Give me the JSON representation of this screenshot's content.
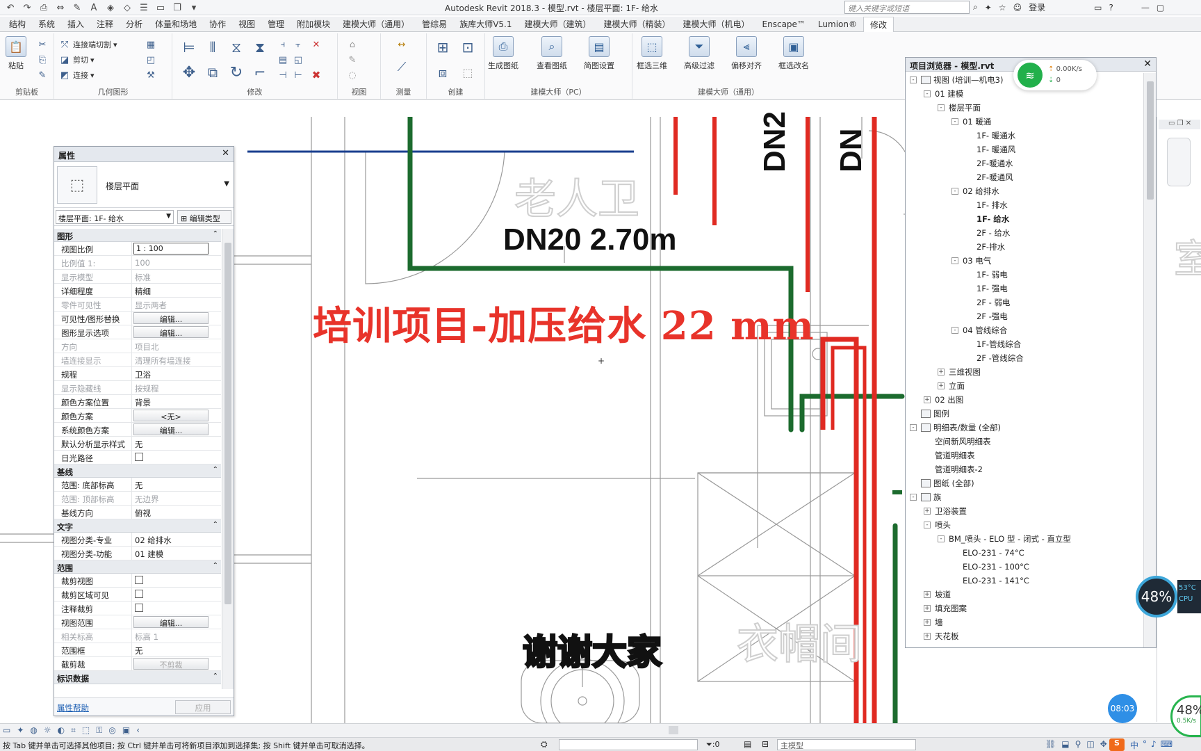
{
  "app": {
    "title": "Autodesk Revit 2018.3 -     模型.rvt - 楼层平面: 1F- 给水",
    "search_placeholder": "键入关键字或短语",
    "login": "登录"
  },
  "tabs": [
    "结构",
    "系统",
    "插入",
    "注释",
    "分析",
    "体量和场地",
    "协作",
    "视图",
    "管理",
    "附加模块",
    "建模大师（通用）",
    "管综易",
    "族库大师V5.1",
    "建模大师（建筑）",
    "建模大师（精装）",
    "建模大师（机电）",
    "Enscape™",
    "Lumion®",
    "修改"
  ],
  "active_tab": "修改",
  "ribbon": {
    "groups": [
      "剪贴板",
      "几何图形",
      "修改",
      "视图",
      "测量",
      "创建",
      "建模大师（PC）",
      "建模大师（通用）"
    ],
    "clipboard_paste": "粘贴",
    "geometry_items": [
      "连接端切割",
      "剪切",
      "连接"
    ],
    "pc_buttons": [
      "生成图纸",
      "查看图纸",
      "简图设置"
    ],
    "general_buttons": [
      "框选三维",
      "高级过滤",
      "偏移对齐",
      "框选改名"
    ]
  },
  "properties": {
    "title": "属性",
    "type_name": "楼层平面",
    "filter": "楼层平面: 1F- 给水",
    "edit_type": "编辑类型",
    "categories": {
      "graphics": "图形",
      "underlay": "基线",
      "text": "文字",
      "extents": "范围",
      "identity": "标识数据"
    },
    "graphics_rows": [
      {
        "k": "视图比例",
        "v": "1 : 100",
        "kind": "input"
      },
      {
        "k": "比例值 1:",
        "v": "100",
        "kind": "dim"
      },
      {
        "k": "显示模型",
        "v": "标准",
        "kind": "dim"
      },
      {
        "k": "详细程度",
        "v": "精细",
        "kind": "text"
      },
      {
        "k": "零件可见性",
        "v": "显示两者",
        "kind": "dim"
      },
      {
        "k": "可见性/图形替换",
        "v": "编辑...",
        "kind": "button"
      },
      {
        "k": "图形显示选项",
        "v": "编辑...",
        "kind": "button"
      },
      {
        "k": "方向",
        "v": "项目北",
        "kind": "dim"
      },
      {
        "k": "墙连接显示",
        "v": "清理所有墙连接",
        "kind": "dim"
      },
      {
        "k": "规程",
        "v": "卫浴",
        "kind": "text"
      },
      {
        "k": "显示隐藏线",
        "v": "按规程",
        "kind": "dim"
      },
      {
        "k": "颜色方案位置",
        "v": "背景",
        "kind": "text"
      },
      {
        "k": "颜色方案",
        "v": "<无>",
        "kind": "button"
      },
      {
        "k": "系统颜色方案",
        "v": "编辑...",
        "kind": "button"
      },
      {
        "k": "默认分析显示样式",
        "v": "无",
        "kind": "text"
      },
      {
        "k": "日光路径",
        "v": "",
        "kind": "checkbox"
      }
    ],
    "underlay_rows": [
      {
        "k": "范围: 底部标高",
        "v": "无",
        "kind": "text"
      },
      {
        "k": "范围: 顶部标高",
        "v": "无边界",
        "kind": "dim"
      },
      {
        "k": "基线方向",
        "v": "俯视",
        "kind": "text"
      }
    ],
    "text_rows": [
      {
        "k": "视图分类-专业",
        "v": "02 给排水",
        "kind": "text"
      },
      {
        "k": "视图分类-功能",
        "v": "01 建模",
        "kind": "text"
      }
    ],
    "extents_rows": [
      {
        "k": "裁剪视图",
        "v": "",
        "kind": "checkbox"
      },
      {
        "k": "裁剪区域可见",
        "v": "",
        "kind": "checkbox"
      },
      {
        "k": "注释裁剪",
        "v": "",
        "kind": "checkbox"
      },
      {
        "k": "视图范围",
        "v": "编辑...",
        "kind": "button"
      },
      {
        "k": "相关标高",
        "v": "标高 1",
        "kind": "dim"
      },
      {
        "k": "范围框",
        "v": "无",
        "kind": "text"
      },
      {
        "k": "截剪裁",
        "v": "不剪裁",
        "kind": "buttondim"
      }
    ],
    "help_link": "属性帮助",
    "apply": "应用"
  },
  "browser": {
    "title": "项目浏览器 - 模型.rvt",
    "nodes": [
      {
        "label": "视图 (培训—机电3)",
        "lvl": 0,
        "exp": "-",
        "icon": true
      },
      {
        "label": "01 建模",
        "lvl": 1,
        "exp": "-"
      },
      {
        "label": "楼层平面",
        "lvl": 2,
        "exp": "-"
      },
      {
        "label": "01 暖通",
        "lvl": 3,
        "exp": "-"
      },
      {
        "label": "1F- 暖通水",
        "lvl": 4
      },
      {
        "label": "1F- 暖通风",
        "lvl": 4
      },
      {
        "label": "2F-暖通水",
        "lvl": 4
      },
      {
        "label": "2F-暖通风",
        "lvl": 4
      },
      {
        "label": "02 给排水",
        "lvl": 3,
        "exp": "-"
      },
      {
        "label": "1F- 排水",
        "lvl": 4
      },
      {
        "label": "1F- 给水",
        "lvl": 4,
        "bold": true
      },
      {
        "label": "2F - 给水",
        "lvl": 4
      },
      {
        "label": "2F-排水",
        "lvl": 4
      },
      {
        "label": "03 电气",
        "lvl": 3,
        "exp": "-"
      },
      {
        "label": "1F- 弱电",
        "lvl": 4
      },
      {
        "label": "1F- 强电",
        "lvl": 4
      },
      {
        "label": "2F - 弱电",
        "lvl": 4
      },
      {
        "label": "2F -强电",
        "lvl": 4
      },
      {
        "label": "04 管线综合",
        "lvl": 3,
        "exp": "-"
      },
      {
        "label": "1F-管线综合",
        "lvl": 4
      },
      {
        "label": "2F -管线综合",
        "lvl": 4
      },
      {
        "label": "三维视图",
        "lvl": 2,
        "exp": "+"
      },
      {
        "label": "立面",
        "lvl": 2,
        "exp": "+"
      },
      {
        "label": "02 出图",
        "lvl": 1,
        "exp": "+"
      },
      {
        "label": "图例",
        "lvl": 0,
        "icon": true
      },
      {
        "label": "明细表/数量 (全部)",
        "lvl": 0,
        "exp": "-",
        "icon": true
      },
      {
        "label": "空间新风明细表",
        "lvl": 1
      },
      {
        "label": "管道明细表",
        "lvl": 1
      },
      {
        "label": "管道明细表-2",
        "lvl": 1
      },
      {
        "label": "图纸 (全部)",
        "lvl": 0,
        "icon": true
      },
      {
        "label": "族",
        "lvl": 0,
        "exp": "-",
        "icon": true
      },
      {
        "label": "卫浴装置",
        "lvl": 1,
        "exp": "+"
      },
      {
        "label": "喷头",
        "lvl": 1,
        "exp": "-"
      },
      {
        "label": "BM_喷头 - ELO 型 - 闭式 - 直立型",
        "lvl": 2,
        "exp": "-"
      },
      {
        "label": "ELO-231 - 74°C",
        "lvl": 3
      },
      {
        "label": "ELO-231 - 100°C",
        "lvl": 3
      },
      {
        "label": "ELO-231 - 141°C",
        "lvl": 3
      },
      {
        "label": "坡道",
        "lvl": 1,
        "exp": "+"
      },
      {
        "label": "填充图案",
        "lvl": 1,
        "exp": "+"
      },
      {
        "label": "墙",
        "lvl": 1,
        "exp": "+"
      },
      {
        "label": "天花板",
        "lvl": 1,
        "exp": "+"
      }
    ]
  },
  "canvas": {
    "pipe_label": "DN20 2.70m",
    "vert_label_1": "DN2",
    "vert_label_2": "DN",
    "room_1": "老人卫",
    "room_2": "衣帽间",
    "room_3": "室",
    "overlay_title": "培训项目-加压给水 22 mm",
    "caption": "谢谢大家"
  },
  "status": {
    "message": "按 Tab 键并单击可选择其他项目; 按 Ctrl 键并单击可将新项目添加到选择集; 按 Shift 键并单击可取消选择。",
    "count": ":0",
    "model": "主模型"
  },
  "overlays": {
    "net_up": "0.00K/s",
    "net_down": "0",
    "cpu": "48%",
    "temp": "53°C",
    "cpu_label": "CPU",
    "clock": "08:03",
    "cpu_small": "48%",
    "speed_small": "0.5K/s"
  },
  "colors": {
    "supply_green": "#1c6b2e",
    "pressurized_red": "#e02a22",
    "overlay_red": "#e8332a",
    "line_blue": "#1a3f8f"
  }
}
